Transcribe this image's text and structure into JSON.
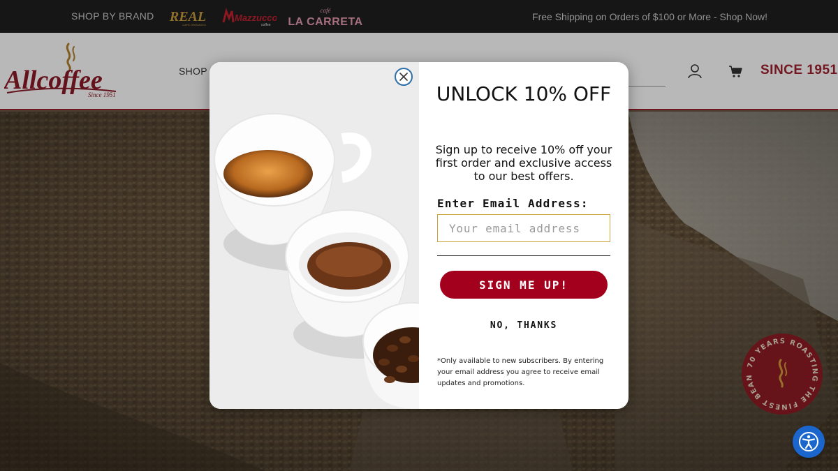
{
  "topbar": {
    "shop_by_brand": "SHOP BY BRAND",
    "brands": [
      "REAL",
      "Mazzucco",
      "LA CARRETA"
    ],
    "brand_sub": {
      "real": "CAFE ORGANICO",
      "mazzucco": "coffee",
      "carreta_top": "café"
    },
    "shipping": "Free Shipping on Orders of $100 or More - Shop Now!"
  },
  "header": {
    "logo_text": "Allcoffee",
    "logo_since": "Since 1951",
    "nav_shop": "SHOP",
    "since_text": "SINCE 1951",
    "icons": {
      "account": "user-icon",
      "cart": "cart-icon"
    }
  },
  "badge": {
    "text": "70 YEARS ROASTING THE FINEST BEANS"
  },
  "popup": {
    "title": "UNLOCK 10% OFF",
    "description": "Sign up to receive 10% off your first order and exclusive access to our best offers.",
    "email_label": "Enter Email Address:",
    "email_placeholder": "Your email address",
    "email_value": "",
    "submit_label": "SIGN ME UP!",
    "decline_label": "NO, THANKS",
    "fine_print": "*Only available to new subscribers. By entering your email address you agree to receive email updates and promotions."
  },
  "colors": {
    "brand_red": "#a3001e",
    "topbar_bg": "#1f1f1f",
    "input_border": "#c9a23a",
    "a11y_blue": "#1a66cc"
  }
}
